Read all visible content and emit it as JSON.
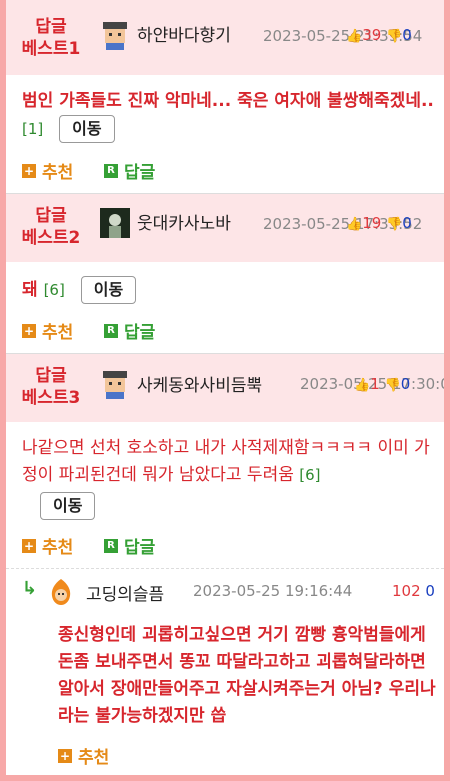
{
  "comments": [
    {
      "badge_line1": "답글",
      "badge_line2": "베스트1",
      "nickname": "하얀바다향기",
      "datetime": "2023-05-25 21:39:54",
      "up": "39",
      "down": "0",
      "text": "범인 가족들도 진짜 악마네... 죽은 여자애 불쌍해죽겠네..",
      "reply_count": "[1]",
      "move_label": "이동",
      "recommend_label": "추천",
      "reply_label": "답글"
    },
    {
      "badge_line1": "답글",
      "badge_line2": "베스트2",
      "nickname": "웃대카사노바",
      "datetime": "2023-05-25 17:33:52",
      "up": "19",
      "down": "0",
      "text": "돼",
      "reply_count": "[6]",
      "move_label": "이동",
      "recommend_label": "추천",
      "reply_label": "답글"
    },
    {
      "badge_line1": "답글",
      "badge_line2": "베스트3",
      "nickname": "사케동와사비듬뿍",
      "datetime": "2023-05-25 17:30:05",
      "up": "1",
      "down": "0",
      "text": "나같으면 선처 호소하고 내가 사적제재함ㅋㅋㅋㅋ 이미 가정이 파괴된건데 뭐가 남았다고 두려움",
      "reply_count": "[6]",
      "move_label": "이동",
      "recommend_label": "추천",
      "reply_label": "답글"
    }
  ],
  "reply": {
    "nickname": "고딩의슬픔",
    "datetime": "2023-05-25 19:16:44",
    "up": "102",
    "down": "0",
    "text": "종신형인데 괴롭히고싶으면 거기 깜빵 흉악범들에게 돈좀 보내주면서 똥꼬 따달라고하고 괴롭혀달라하면 알아서 장애만들어주고 자살시켜주는거 아님? 우리나라는 불가능하겠지만 씁",
    "recommend_label": "추천"
  },
  "colors": {
    "accent_red": "#d7262d",
    "header_bg": "#fde5e7",
    "border_pink": "#f7a8a8",
    "orange": "#e58a17",
    "green": "#35a035",
    "down_blue": "#1a3fbf"
  },
  "icons": [
    "thumbs-up-icon",
    "thumbs-down-icon",
    "plus-icon",
    "reply-r-icon",
    "reply-arrow-icon"
  ]
}
